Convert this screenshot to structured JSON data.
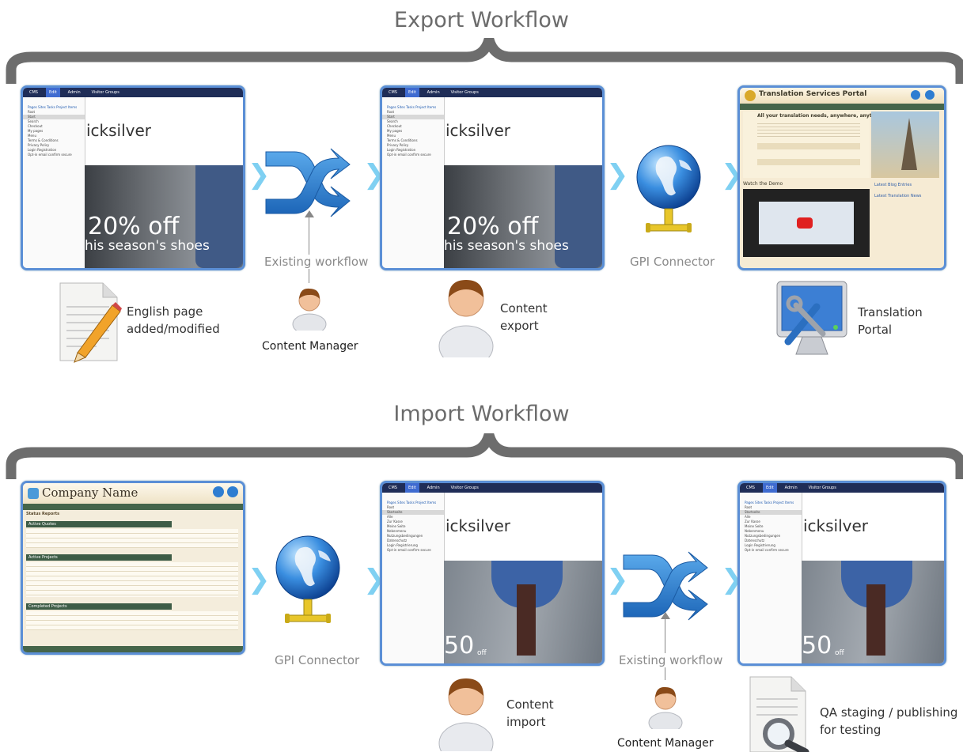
{
  "export": {
    "title": "Export Workflow",
    "existing_workflow": "Existing workflow",
    "gpi_label": "GPI Connector",
    "content_manager": "Content Manager",
    "english_page": "English page added/modified",
    "content_export": "Content export",
    "translation_portal": "Translation Portal",
    "portal_title": "Translation Services Portal",
    "portal_headline": "All your translation needs, anywhere, anytime!",
    "portal_watch": "Watch the Demo",
    "portal_latest_blog": "Latest Blog Entries",
    "portal_latest_news": "Latest Translation News"
  },
  "import": {
    "title": "Import Workflow",
    "existing_workflow": "Existing workflow",
    "gpi_label": "GPI Connector",
    "content_manager": "Content Manager",
    "content_import": "Content import",
    "qa_staging": "QA staging / publishing for testing",
    "company_name": "Company Name",
    "status_reports": "Status Reports",
    "active_quotes": "Active Quotes",
    "active_projects": "Active Projects",
    "completed_projects": "Completed Projects"
  },
  "cms": {
    "tabs": [
      "CMS",
      "Edit",
      "Admin",
      "Visitor Groups"
    ],
    "tree_tabs": "Pages  Sites  Tasks  Project Items",
    "brand": "icksilver",
    "export_promo_big": "20% off",
    "export_promo_small": "his season's shoes",
    "import_promo": "50",
    "import_promo_small": "off",
    "tree_export": [
      "Root",
      "Start",
      "Search",
      "Checkout",
      "My pages",
      "Menu",
      "Terms & Conditions",
      "Privacy Policy",
      "Login Registration",
      "Opt-in email confirm secure"
    ],
    "tree_import": [
      "Root",
      "Startseite",
      "Alle",
      "Zur Kasse",
      "Meine Seite",
      "Nebenmenu",
      "Nutzungsbedingungen",
      "Datenschutz",
      "Login Registrierung",
      "Opt-in email confirm secure"
    ]
  },
  "colors": {
    "frame_blue": "#5b8fd6",
    "chevron": "#7fd0f2",
    "brace": "#6d6d6d",
    "shuffle_blue": "#2a7fd0"
  }
}
